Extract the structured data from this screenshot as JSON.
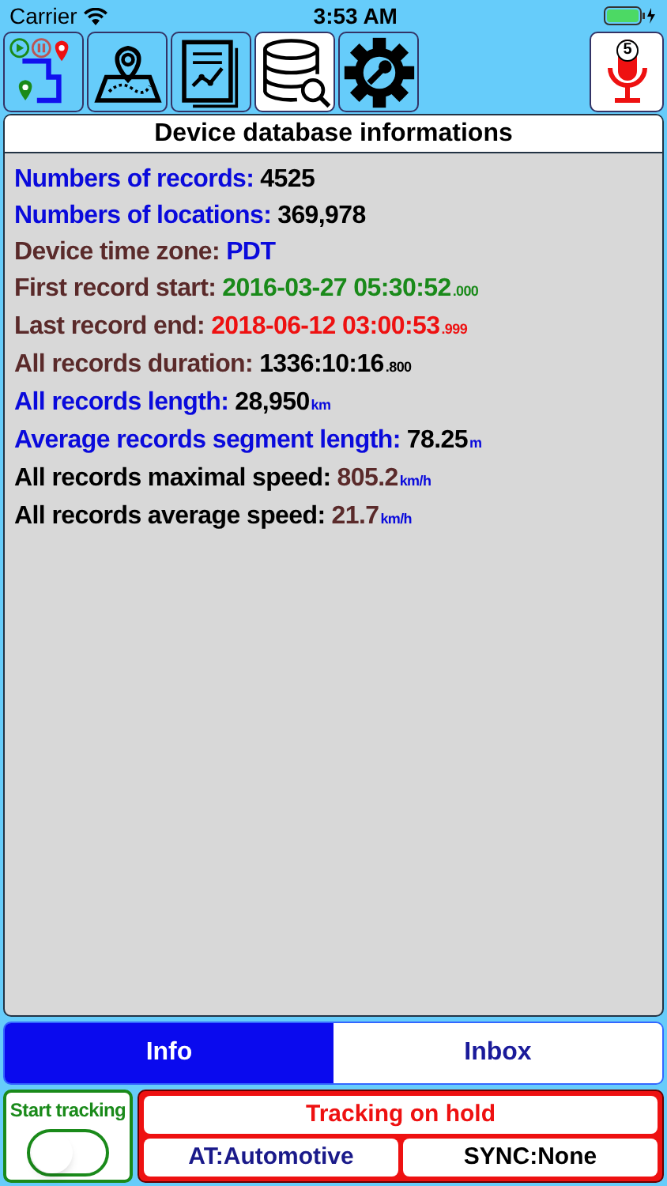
{
  "status_bar": {
    "carrier": "Carrier",
    "time": "3:53 AM"
  },
  "toolbar": [
    {
      "kind": "route",
      "selected": false
    },
    {
      "kind": "map",
      "selected": false
    },
    {
      "kind": "report",
      "selected": false
    },
    {
      "kind": "database",
      "selected": true
    },
    {
      "kind": "settings",
      "selected": false
    }
  ],
  "mic_button": {
    "badge": "5"
  },
  "panel": {
    "title": "Device database informations"
  },
  "records": [
    {
      "label": {
        "text": "Numbers of records:",
        "color": "#0a0adc"
      },
      "value": {
        "text": "4525",
        "color": "#000000"
      }
    },
    {
      "label": {
        "text": "Numbers of locations:",
        "color": "#0a0adc"
      },
      "value": {
        "text": "369,978",
        "color": "#000000"
      }
    },
    {
      "label": {
        "text": "Device time zone:",
        "color": "#5a2a2a"
      },
      "value": {
        "text": "PDT",
        "color": "#0a0adc"
      }
    },
    {
      "label": {
        "text": "First record start:",
        "color": "#5a2a2a"
      },
      "value": {
        "text": "2016-03-27 05:30:52",
        "color": "#1a8a1a"
      },
      "unit": {
        "text": ".000",
        "color": "#1a8a1a"
      }
    },
    {
      "label": {
        "text": "Last record end:",
        "color": "#5a2a2a"
      },
      "value": {
        "text": "2018-06-12 03:00:53",
        "color": "#ee1111"
      },
      "unit": {
        "text": ".999",
        "color": "#ee1111"
      }
    },
    {
      "label": {
        "text": "All records duration:",
        "color": "#5a2a2a"
      },
      "value": {
        "text": "1336:10:16",
        "color": "#000000"
      },
      "unit": {
        "text": ".800",
        "color": "#000000"
      }
    },
    {
      "label": {
        "text": "All records length:",
        "color": "#0a0adc"
      },
      "value": {
        "text": "28,950",
        "color": "#000000"
      },
      "unit": {
        "text": "km",
        "color": "#0a0adc"
      }
    },
    {
      "label": {
        "text": "Average records segment length:",
        "color": "#0a0adc"
      },
      "value": {
        "text": "78.25",
        "color": "#000000"
      },
      "unit": {
        "text": "m",
        "color": "#0a0adc"
      }
    },
    {
      "label": {
        "text": "All records maximal speed:",
        "color": "#000000"
      },
      "value": {
        "text": "805.2",
        "color": "#5a2a2a"
      },
      "unit": {
        "text": "km/h",
        "color": "#0a0adc"
      }
    },
    {
      "label": {
        "text": "All records average speed:",
        "color": "#000000"
      },
      "value": {
        "text": "21.7",
        "color": "#5a2a2a"
      },
      "unit": {
        "text": "km/h",
        "color": "#0a0adc"
      }
    }
  ],
  "tabs": [
    {
      "label": "Info",
      "selected": true
    },
    {
      "label": "Inbox",
      "selected": false
    }
  ],
  "tracking": {
    "label": "Start tracking",
    "on": false,
    "status": "Tracking on hold",
    "activity": "AT:Automotive",
    "sync": "SYNC:None"
  }
}
